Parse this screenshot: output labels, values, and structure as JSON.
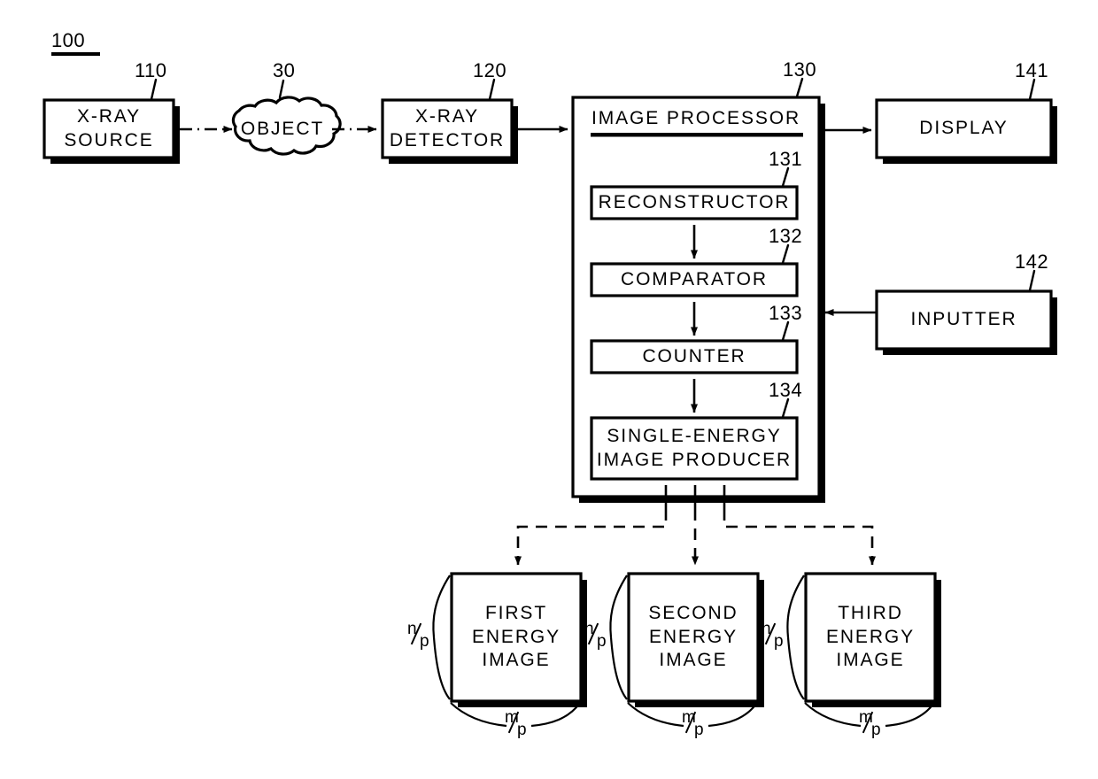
{
  "figure": {
    "system_ref": "100",
    "background": "#ffffff",
    "stroke": "#000000"
  },
  "blocks": {
    "xray_source": {
      "label": "X-RAY\nSOURCE",
      "ref": "110"
    },
    "object": {
      "label": "OBJECT",
      "ref": "30"
    },
    "xray_detector": {
      "label": "X-RAY\nDETECTOR",
      "ref": "120"
    },
    "image_processor": {
      "label": "IMAGE PROCESSOR",
      "ref": "130"
    },
    "reconstructor": {
      "label": "RECONSTRUCTOR",
      "ref": "131"
    },
    "comparator": {
      "label": "COMPARATOR",
      "ref": "132"
    },
    "counter": {
      "label": "COUNTER",
      "ref": "133"
    },
    "single_energy_image_producer": {
      "label": "SINGLE-ENERGY\nIMAGE PRODUCER",
      "ref": "134"
    },
    "display": {
      "label": "DISPLAY",
      "ref": "141"
    },
    "inputter": {
      "label": "INPUTTER",
      "ref": "142"
    }
  },
  "energy_images": [
    {
      "label": "FIRST\nENERGY\nIMAGE",
      "height_dim_numerator": "n",
      "height_dim_denominator": "p",
      "width_dim_numerator": "m",
      "width_dim_denominator": "p"
    },
    {
      "label": "SECOND\nENERGY\nIMAGE",
      "height_dim_numerator": "n",
      "height_dim_denominator": "p",
      "width_dim_numerator": "m",
      "width_dim_denominator": "p"
    },
    {
      "label": "THIRD\nENERGY\nIMAGE",
      "height_dim_numerator": "n",
      "height_dim_denominator": "p",
      "width_dim_numerator": "m",
      "width_dim_denominator": "p"
    }
  ]
}
